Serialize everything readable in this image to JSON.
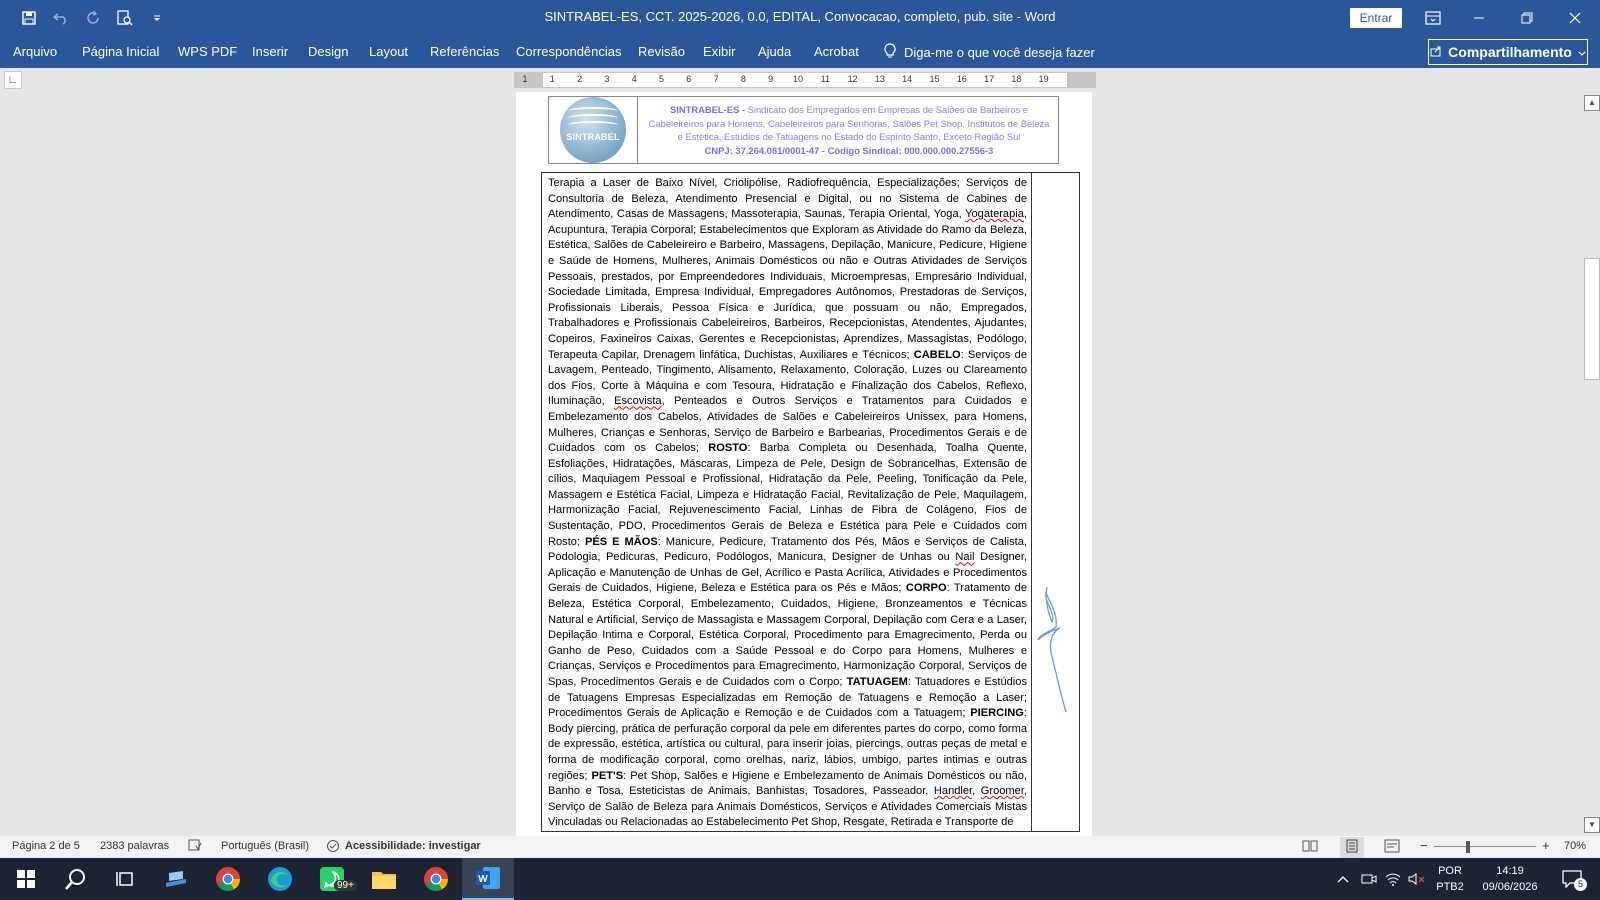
{
  "window": {
    "title": "SINTRABEL-ES, CCT. 2025-2026, 0.0, EDITAL, Convocacao, completo, pub. site  -  Word",
    "signin_label": "Entrar"
  },
  "menu": {
    "items": [
      "Arquivo",
      "Página Inicial",
      "WPS PDF",
      "Inserir",
      "Design",
      "Layout",
      "Referências",
      "Correspondências",
      "Revisão",
      "Exibir",
      "Ajuda",
      "Acrobat"
    ],
    "tell_me": "Diga-me o que você deseja fazer",
    "share_label": "Compartilhamento"
  },
  "ruler": {
    "ticks": [
      "1",
      "1",
      "2",
      "3",
      "4",
      "5",
      "6",
      "7",
      "8",
      "9",
      "10",
      "11",
      "12",
      "13",
      "14",
      "15",
      "16",
      "17",
      "18",
      "19"
    ]
  },
  "document": {
    "header": {
      "org_name": "SINTRABEL-ES -",
      "org_desc": " Sindicato dos Empregados em Empresas de Salões de Barbeiros e Cabeleireiros para Homens, Cabeleireiros para Senhoras, Salões Pet Shop, Institutos de Beleza e Estética, Estúdios de Tatuagens no Estado do Espírito Santo, Exceto Região Sul",
      "cnpj": "CNPJ: 37.264.081/0001-47 - Código Sindical: 000.000.000.27556-3",
      "logo_text": "SINTRABEL"
    },
    "p1": "Terapia a Laser de Baixo Nível, Criolipólise, Radiofrequência, Especializações; Serviços de Consultoria de Beleza, Atendimento Presencial e Digital, ou no Sistema de Cabines de Atendimento, Casas de Massagens, Massoterapia, Saunas, Terapia Oriental, Yoga, ",
    "w_yoga": "Yogaterapia",
    "p2": ", Acupuntura, Terapia Corporal; Estabelecimentos que Exploram as Atividade do Ramo da Beleza, Estética, Salões de Cabeleireiro e Barbeiro, Massagens, Depilação, Manicure, Pedicure, Higiene e Saúde de Homens, Mulheres, Animais Domésticos ou não e Outras Atividades de Serviços Pessoais, prestados, por Empreendedores Individuais, Microempresas, Empresário Individual, Sociedade Limitada, Empresa Individual, Empregadores Autônomos, Prestadoras de Serviços, Profissionais Liberais, Pessoa Física e Jurídica, que possuam ou não, Empregados, Trabalhadores e Profissionais Cabeleireiros, Barbeiros, Recepcionistas, Atendentes, Ajudantes, Copeiros, Faxineiros Caixas, Gerentes e Recepcionistas, Aprendizes, Massagistas, Podólogo, Terapeuta Capilar, Drenagem linfática, Duchistas, Auxiliares e Técnicos; ",
    "h_cabelo": "CABELO",
    "p3": ": Serviços de Lavagem, Penteado, Tingimento, Alisamento, Relaxamento, Coloração, Luzes ou Clareamento dos Fios, Corte à Máquina e com Tesoura, Hidratação e Finalização dos Cabelos, Reflexo, Iluminação, ",
    "w_escovista": "Escovista",
    "p4": ", Penteados e Outros Serviços e Tratamentos para Cuidados e Embelezamento dos Cabelos, Atividades de Salões e Cabeleireiros Unissex, para Homens, Mulheres, Crianças e Senhoras, Serviço de Barbeiro e Barbearias, Procedimentos Gerais e de Cuidados com os Cabelos; ",
    "h_rosto": "ROSTO",
    "p5": ": Barba Completa ou Desenhada, Toalha Quente, Esfoliações, Hidratações, Máscaras, Limpeza de Pele, Design de Sobrancelhas, Extensão de cílios, Maquiagem Pessoal e Profissional, Hidratação da Pele, Peeling, Tonificação da Pele, Massagem e Estética Facial, Limpeza e Hidratação Facial, Revitalização de Pele, Maquilagem, Harmonização Facial, Rejuvenescimento Facial, Linhas de Fibra de Colágeno, Fios de Sustentação, PDO, Procedimentos Gerais de Beleza e Estética para Pele e Cuidados com Rosto; ",
    "h_pes": "PÉS E MÃOS",
    "p6": ": Manicure, Pedicure, Tratamento dos Pés, Mãos e Serviços de Calista, Podologia, Pedicuras, Pedicuro, Podólogos, Manicura, Designer de Unhas ou ",
    "w_nail": "Nail",
    "p7": " Designer, Aplicação e Manutenção de Unhas de Gel, Acrílico e Pasta Acrílica, Atividades e Procedimentos Gerais de Cuidados, Higiene, Beleza e Estética para os Pés e Mãos; ",
    "h_corpo": "CORPO",
    "p8": ": Tratamento de Beleza, Estética Corporal, Embelezamento, Cuidados, Higiene, Bronzeamentos e Técnicas Natural e Artificial, Serviço de Massagista e Massagem Corporal, Depilação com Cera e a Laser, Depilação Intima e Corporal, Estética Corporal, Procedimento para Emagrecimento, Perda ou Ganho de Peso, Cuidados com a Saúde Pessoal e do Corpo para Homens, Mulheres e Crianças, Serviços e Procedimentos para Emagrecimento, Harmonização Corporal, Serviços de Spas, Procedimentos Gerais e de Cuidados com o Corpo; ",
    "h_tatuagem": "TATUAGEM",
    "p9": ": Tatuadores e Estúdios de Tatuagens Empresas Especializadas em Remoção de Tatuagens e Remoção a Laser; Procedimentos Gerais de Aplicação e Remoção e de Cuidados com a Tatuagem; ",
    "h_piercing": "PIERCING",
    "p10": ": Body piercing, prática de perfuração corporal da pele em diferentes partes do corpo, como forma de expressão, estética, artística ou cultural, para inserir joias, piercings, outras peças de metal e forma de modificação corporal, como orelhas, nariz, lábios, umbigo, partes intimas e outras regiões; ",
    "h_pets": "PET'S",
    "p11": ": Pet Shop, Salões e Higiene e Embelezamento de Animais Domésticos ou não, Banho e Tosa, Esteticistas de Animais, Banhistas, Tosadores, Passeador, ",
    "w_handler": "Handler",
    "p12": ", ",
    "w_groomer": "Groomer",
    "p13": ", Serviço de Salão de Beleza para Animais Domésticos, Serviços e Atividades Comerciais Mistas Vinculadas ou Relacionadas ao Estabelecimento Pet Shop, Resgate, Retirada e Transporte de"
  },
  "status": {
    "page": "Página 2 de 5",
    "words": "2383 palavras",
    "language": "Português (Brasil)",
    "accessibility": "Acessibilidade: investigar",
    "zoom": "70%"
  },
  "taskbar": {
    "whatsapp_badge": "99+",
    "lang_top": "POR",
    "lang_bottom": "PTB2",
    "time": "14:19",
    "date": "09/06/2026",
    "notif_count": "5"
  },
  "colors": {
    "accent": "#2b579a",
    "header_text": "#8b7fd4"
  }
}
